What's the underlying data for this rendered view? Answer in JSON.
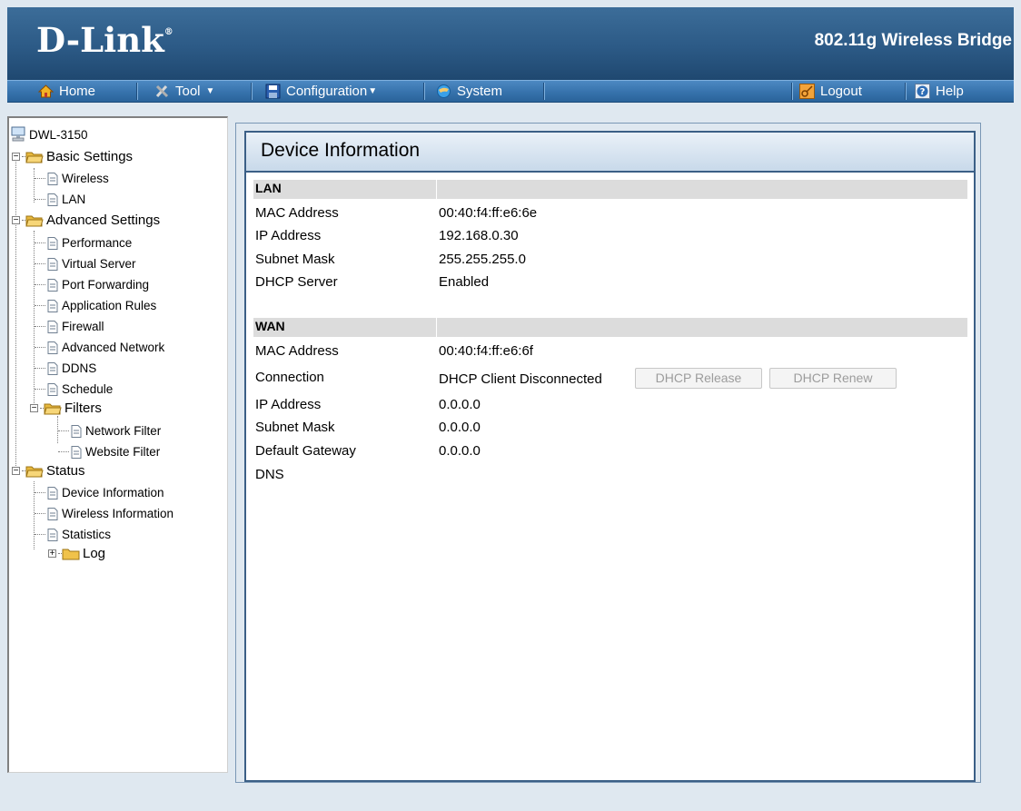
{
  "header": {
    "logo_text": "D-Link",
    "logo_mark": "®",
    "product": "802.11g Wireless Bridge",
    "colors": {
      "header": "#2c5a86",
      "toolbar": "#3874ae"
    }
  },
  "toolbar": {
    "home": "Home",
    "tool": "Tool",
    "configuration": "Configuration",
    "system": "System",
    "logout": "Logout",
    "help": "Help",
    "icons": [
      "home-icon",
      "tool-icon",
      "configuration-icon",
      "system-icon",
      "logout-icon",
      "help-icon"
    ]
  },
  "sidebar": {
    "device": "DWL-3150",
    "basic_settings": "Basic Settings",
    "wireless": "Wireless",
    "lan": "LAN",
    "advanced_settings": "Advanced Settings",
    "performance": "Performance",
    "virtual_server": "Virtual Server",
    "port_forwarding": "Port Forwarding",
    "application_rules": "Application Rules",
    "firewall": "Firewall",
    "advanced_network": "Advanced Network",
    "ddns": "DDNS",
    "schedule": "Schedule",
    "filters": "Filters",
    "network_filter": "Network Filter",
    "website_filter": "Website Filter",
    "status": "Status",
    "device_information": "Device Information",
    "wireless_information": "Wireless Information",
    "statistics": "Statistics",
    "log": "Log"
  },
  "panel": {
    "title": "Device Information",
    "lan": {
      "heading": "LAN",
      "mac_label": "MAC Address",
      "mac": "00:40:f4:ff:e6:6e",
      "ip_label": "IP Address",
      "ip": "192.168.0.30",
      "mask_label": "Subnet Mask",
      "mask": "255.255.255.0",
      "dhcp_label": "DHCP Server",
      "dhcp": "Enabled"
    },
    "wan": {
      "heading": "WAN",
      "mac_label": "MAC Address",
      "mac": "00:40:f4:ff:e6:6f",
      "conn_label": "Connection",
      "conn": "DHCP Client Disconnected",
      "release_button": "DHCP Release",
      "renew_button": "DHCP Renew",
      "ip_label": "IP Address",
      "ip": "0.0.0.0",
      "mask_label": "Subnet Mask",
      "mask": "0.0.0.0",
      "gateway_label": "Default Gateway",
      "gateway": "0.0.0.0",
      "dns_label": "DNS",
      "dns": ""
    }
  }
}
